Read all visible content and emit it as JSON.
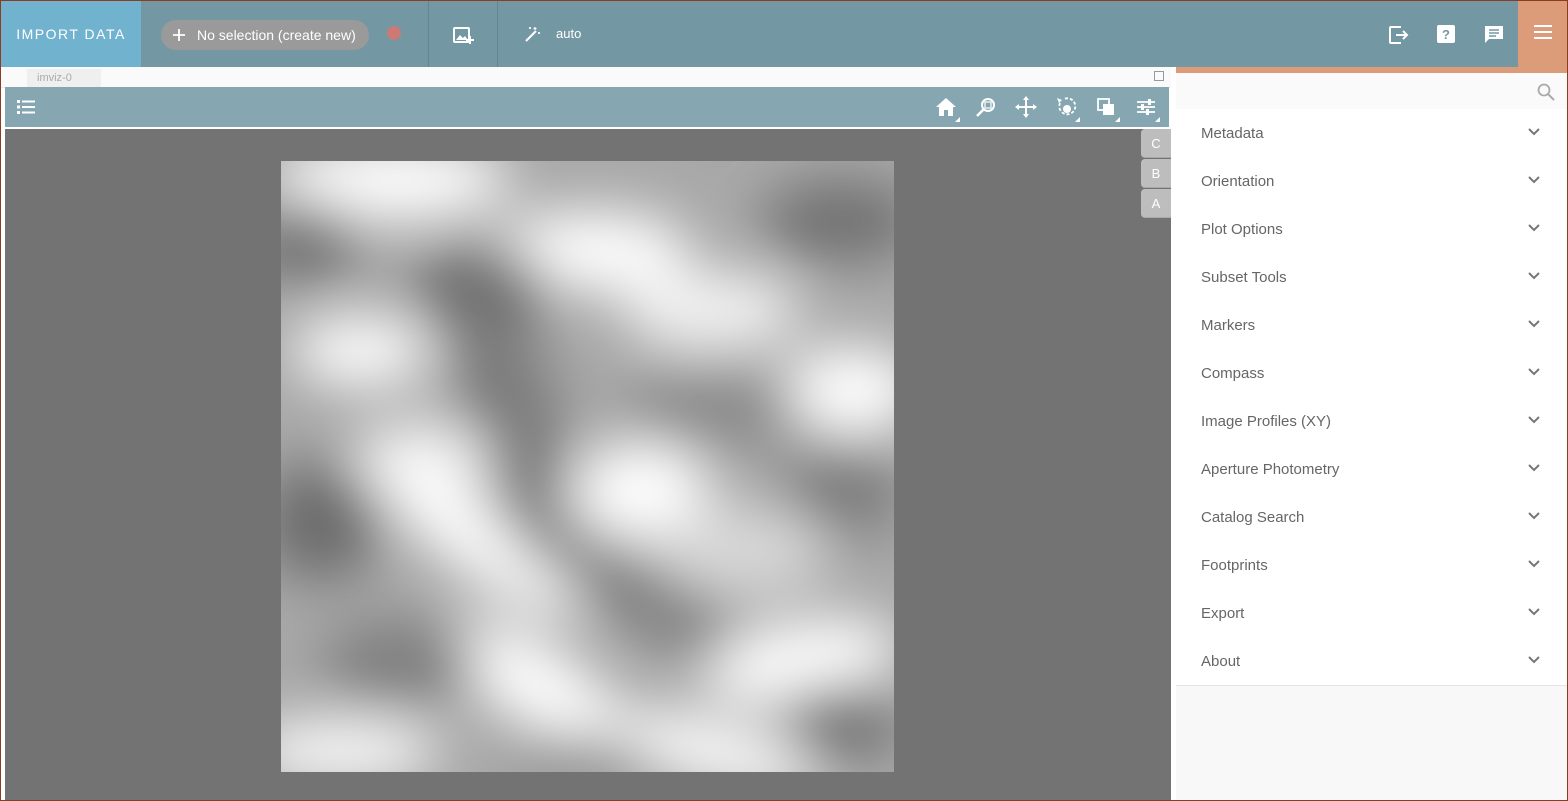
{
  "topbar": {
    "import_label": "IMPORT DATA",
    "selection_label": "No selection (create new)",
    "auto_label": "auto",
    "icons": [
      "plus-icon",
      "record-dot-icon",
      "add-image-icon",
      "magic-wand-icon",
      "export-icon",
      "help-icon",
      "feedback-icon",
      "menu-icon"
    ],
    "colors": {
      "bar": "#7498a3",
      "import": "#71b3cf",
      "accent": "#dc9c79"
    }
  },
  "viewer": {
    "tab_label": "imviz-0",
    "layers": [
      "C",
      "B",
      "A"
    ],
    "tools": [
      "home-icon",
      "zoom-box-icon",
      "pan-icon",
      "rotate-zoom-icon",
      "layers-icon",
      "settings-sliders-icon"
    ]
  },
  "tray": {
    "search_placeholder": "",
    "plugins": [
      {
        "label": "Metadata"
      },
      {
        "label": "Orientation"
      },
      {
        "label": "Plot Options"
      },
      {
        "label": "Subset Tools"
      },
      {
        "label": "Markers"
      },
      {
        "label": "Compass"
      },
      {
        "label": "Image Profiles (XY)"
      },
      {
        "label": "Aperture Photometry"
      },
      {
        "label": "Catalog Search"
      },
      {
        "label": "Footprints"
      },
      {
        "label": "Export"
      },
      {
        "label": "About"
      }
    ]
  }
}
